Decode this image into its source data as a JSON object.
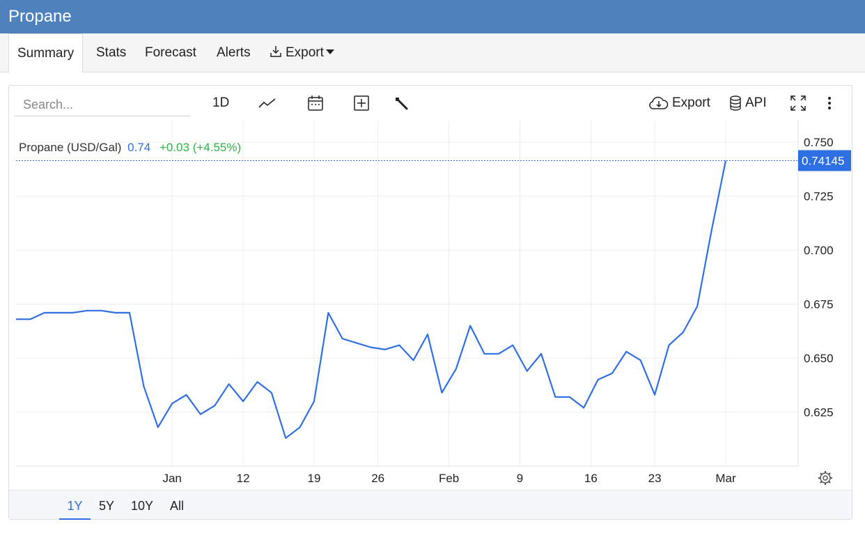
{
  "app": {
    "title": "Propane"
  },
  "tabs": [
    {
      "label": "Summary",
      "active": true
    },
    {
      "label": "Stats"
    },
    {
      "label": "Forecast"
    },
    {
      "label": "Alerts"
    },
    {
      "label": "Export"
    }
  ],
  "toolbar": {
    "search_placeholder": "Search...",
    "interval_label": "1D",
    "export_label": "Export",
    "api_label": "API"
  },
  "legend": {
    "name": "Propane (USD/Gal)",
    "value": "0.74",
    "change": "+0.03 (+4.55%)",
    "value_color": "#2f6fe4",
    "change_color": "#2fb344"
  },
  "ranges": [
    {
      "label": "1Y",
      "active": true
    },
    {
      "label": "5Y"
    },
    {
      "label": "10Y"
    },
    {
      "label": "All"
    }
  ],
  "chart_data": {
    "type": "line",
    "ylim": [
      0.6,
      0.76
    ],
    "y_ticks": [
      0.625,
      0.65,
      0.675,
      0.7,
      0.725,
      0.75
    ],
    "y_tick_labels": [
      "0.625",
      "0.650",
      "0.675",
      "0.700",
      "0.725",
      "0.750"
    ],
    "x_ticks": [
      {
        "label": "Jan",
        "index": 11
      },
      {
        "label": "12",
        "index": 16
      },
      {
        "label": "19",
        "index": 21
      },
      {
        "label": "26",
        "index": 25.5
      },
      {
        "label": "Feb",
        "index": 30.5
      },
      {
        "label": "9",
        "index": 35.5
      },
      {
        "label": "16",
        "index": 40.5
      },
      {
        "label": "23",
        "index": 45
      },
      {
        "label": "Mar",
        "index": 50
      }
    ],
    "last_value_label": "0.74145",
    "line_color": "#2f6fe4",
    "series": [
      {
        "values": [
          0.668,
          0.668,
          0.671,
          0.671,
          0.671,
          0.672,
          0.672,
          0.671,
          0.671,
          0.637,
          0.618,
          0.629,
          0.633,
          0.624,
          0.628,
          0.638,
          0.63,
          0.639,
          0.634,
          0.613,
          0.618,
          0.63,
          0.671,
          0.659,
          0.657,
          0.655,
          0.654,
          0.656,
          0.649,
          0.661,
          0.634,
          0.645,
          0.665,
          0.652,
          0.652,
          0.656,
          0.644,
          0.652,
          0.632,
          0.632,
          0.627,
          0.64,
          0.643,
          0.653,
          0.649,
          0.633,
          0.656,
          0.662,
          0.674,
          0.709,
          0.74145
        ]
      }
    ]
  }
}
